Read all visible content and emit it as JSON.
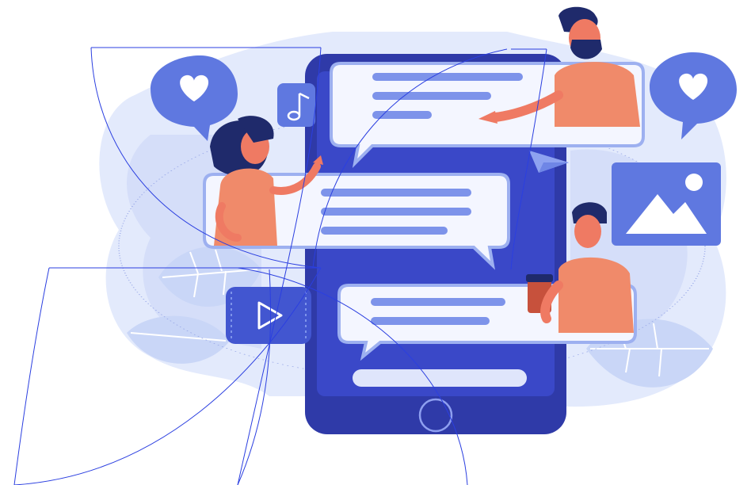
{
  "scene": {
    "people": [
      "woman",
      "bearded-man",
      "man-with-cup"
    ],
    "icons": [
      "heart-icon",
      "heart-icon",
      "music-note-icon",
      "send-icon",
      "image-icon",
      "play-icon"
    ],
    "message_bubbles": 3,
    "colors": {
      "phone_body": "#2f3aa8",
      "phone_screen": "#3a48c8",
      "accent_blue": "#5f78e0",
      "bubble_fill": "#f4f6ff",
      "bubble_line": "#7d93ea",
      "skin_orange": "#ef7a63",
      "shirt_orange": "#f08a6a",
      "hair_dark": "#1f2a6b",
      "background_blob": "#dbe4fb",
      "leaf_light": "#c9d6f7",
      "arc_lines": "#2b3fe0"
    }
  }
}
